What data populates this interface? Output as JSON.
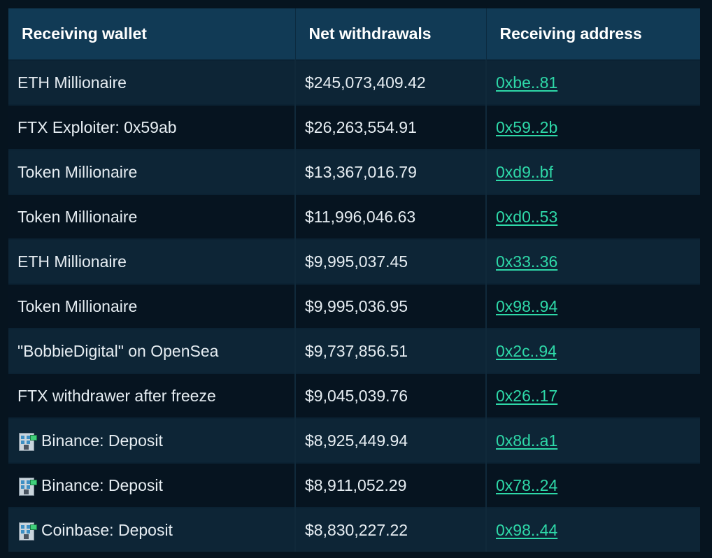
{
  "table": {
    "headers": [
      "Receiving wallet",
      "Net withdrawals",
      "Receiving address"
    ],
    "rows": [
      {
        "wallet": "ETH Millionaire",
        "icon": "",
        "amount": "$245,073,409.42",
        "address": "0xbe..81"
      },
      {
        "wallet": "FTX Exploiter: 0x59ab",
        "icon": "",
        "amount": "$26,263,554.91",
        "address": "0x59..2b"
      },
      {
        "wallet": "Token Millionaire",
        "icon": "",
        "amount": "$13,367,016.79",
        "address": "0xd9..bf"
      },
      {
        "wallet": "Token Millionaire",
        "icon": "",
        "amount": "$11,996,046.63",
        "address": "0xd0..53"
      },
      {
        "wallet": "ETH Millionaire",
        "icon": "",
        "amount": "$9,995,037.45",
        "address": "0x33..36"
      },
      {
        "wallet": "Token Millionaire",
        "icon": "",
        "amount": "$9,995,036.95",
        "address": "0x98..94"
      },
      {
        "wallet": "\"BobbieDigital\" on OpenSea",
        "icon": "",
        "amount": "$9,737,856.51",
        "address": "0x2c..94"
      },
      {
        "wallet": "FTX withdrawer after freeze",
        "icon": "",
        "amount": "$9,045,039.76",
        "address": "0x26..17"
      },
      {
        "wallet": "Binance: Deposit",
        "icon": "office-building-icon",
        "amount": "$8,925,449.94",
        "address": "0x8d..a1"
      },
      {
        "wallet": "Binance: Deposit",
        "icon": "office-building-icon",
        "amount": "$8,911,052.29",
        "address": "0x78..24"
      },
      {
        "wallet": "Coinbase: Deposit",
        "icon": "office-building-icon",
        "amount": "$8,830,227.22",
        "address": "0x98..44"
      }
    ]
  },
  "colors": {
    "header_bg": "#113a55",
    "row_odd": "#0d2536",
    "row_even": "#061420",
    "link": "#2ed8a8",
    "text": "#e6edf2"
  }
}
